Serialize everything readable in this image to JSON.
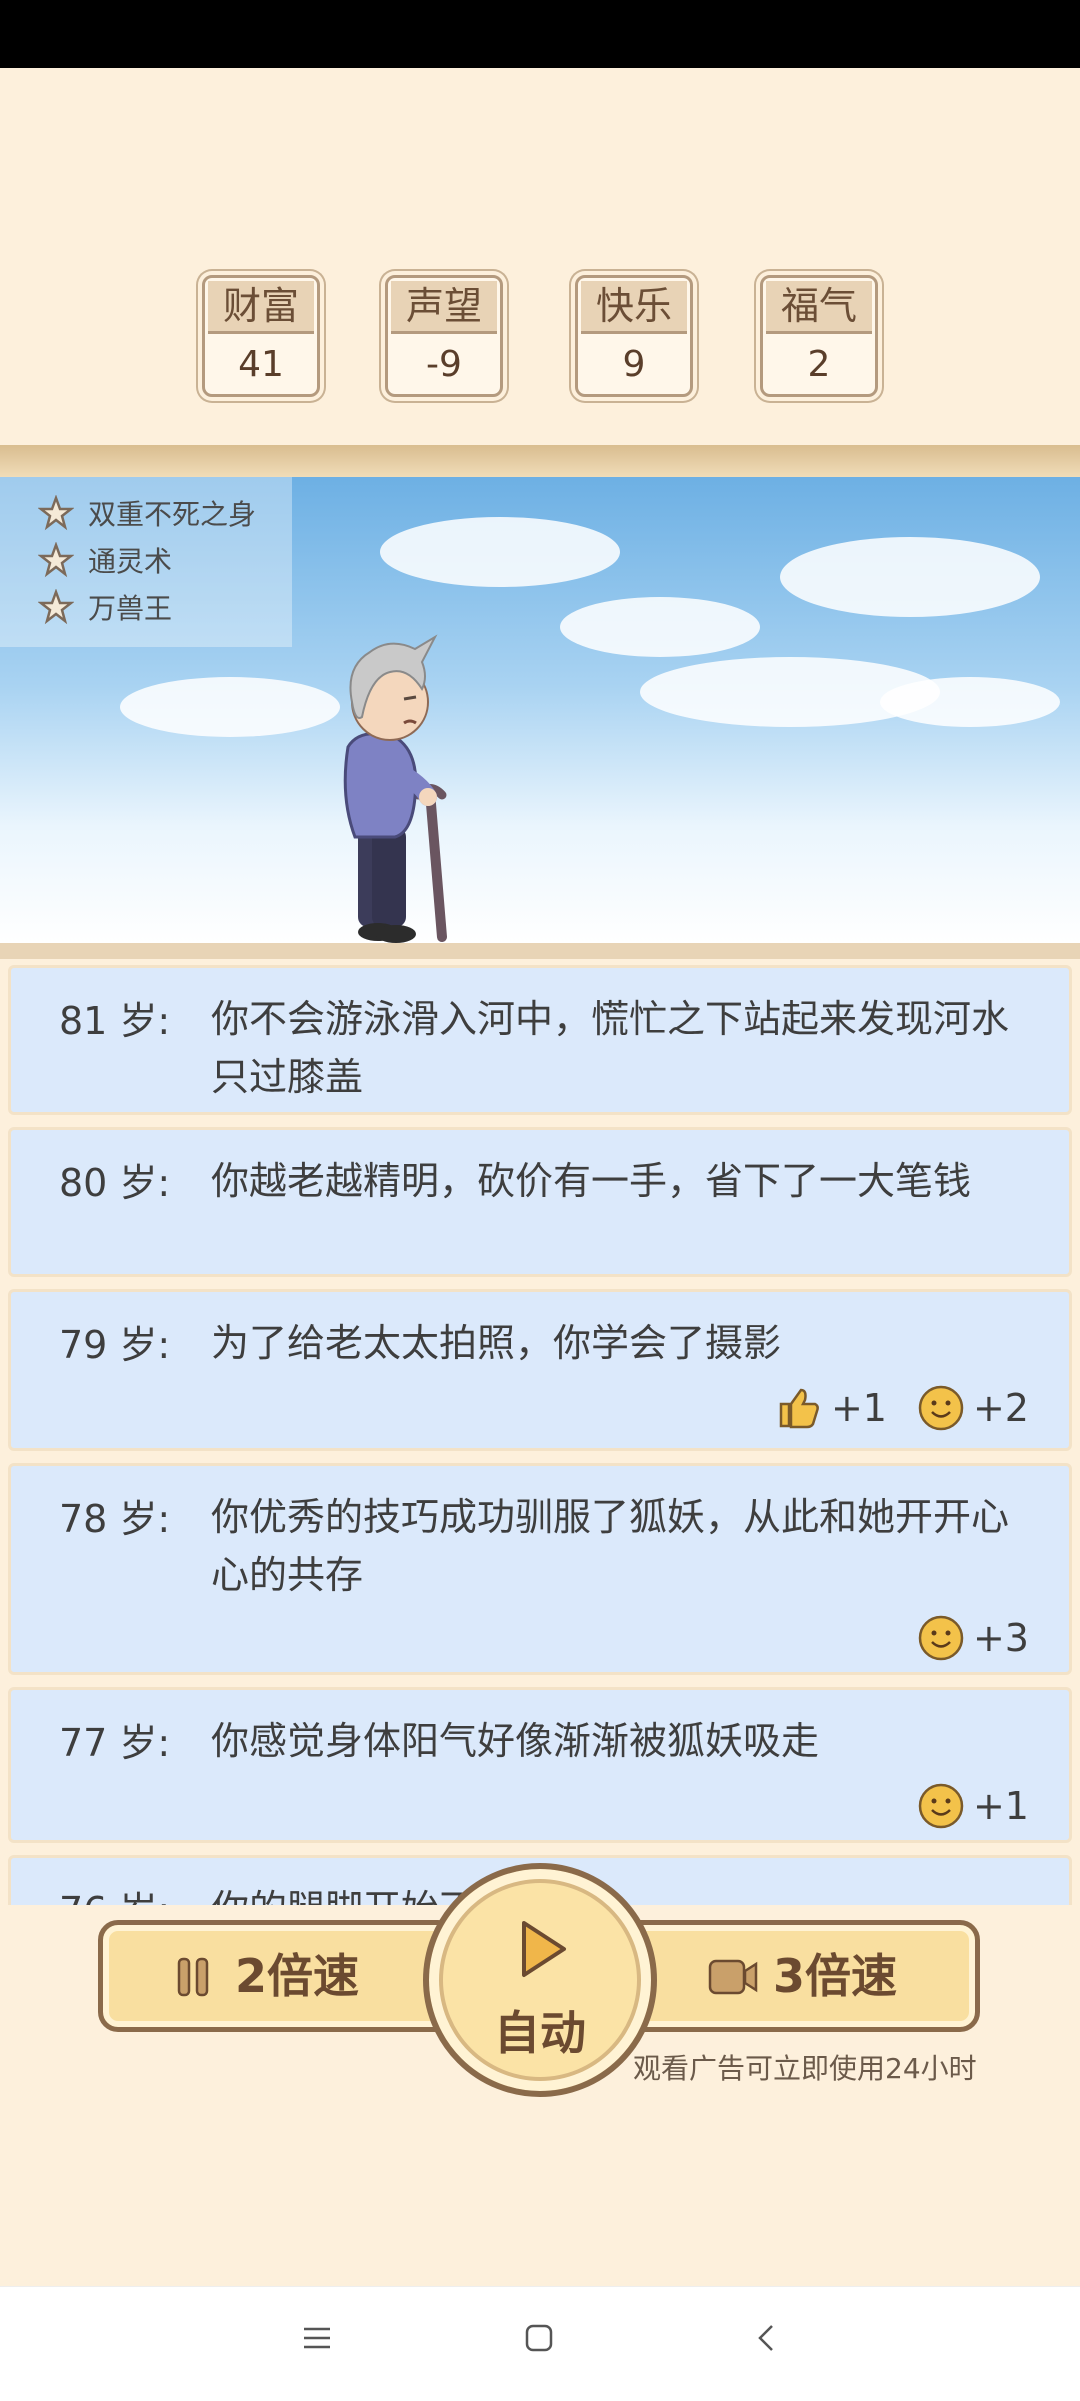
{
  "stats": [
    {
      "label": "财富",
      "value": "41"
    },
    {
      "label": "声望",
      "value": "-9"
    },
    {
      "label": "快乐",
      "value": "9"
    },
    {
      "label": "福气",
      "value": "2"
    }
  ],
  "talents": [
    "双重不死之身",
    "通灵术",
    "万兽王"
  ],
  "log": [
    {
      "age": "81 岁:",
      "event": "你不会游泳滑入河中，慌忙之下站起来发现河水只过膝盖",
      "rewards": []
    },
    {
      "age": "80 岁:",
      "event": "你越老越精明，砍价有一手，省下了一大笔钱",
      "rewards": []
    },
    {
      "age": "79 岁:",
      "event": "为了给老太太拍照，你学会了摄影",
      "rewards": [
        {
          "icon": "thumbs-up-icon",
          "value": "+1"
        },
        {
          "icon": "smile-icon",
          "value": "+2"
        }
      ]
    },
    {
      "age": "78 岁:",
      "event": "你优秀的技巧成功驯服了狐妖，从此和她开开心心的共存",
      "rewards": [
        {
          "icon": "smile-icon",
          "value": "+3"
        }
      ]
    },
    {
      "age": "77 岁:",
      "event": "你感觉身体阳气好像渐渐被狐妖吸走",
      "rewards": [
        {
          "icon": "smile-icon",
          "value": "+1"
        }
      ]
    },
    {
      "age": "76 岁:",
      "event": "你的腿脚开始不太灵活",
      "rewards": []
    }
  ],
  "controls": {
    "speed2_label": "2倍速",
    "auto_label": "自动",
    "speed3_label": "3倍速",
    "ad_note": "观看广告可立即使用24小时"
  },
  "colors": {
    "background": "#fdf0dc",
    "log_entry": "#dbe9fb",
    "button": "#f9dfa0",
    "button_border": "#8a6a4a"
  }
}
